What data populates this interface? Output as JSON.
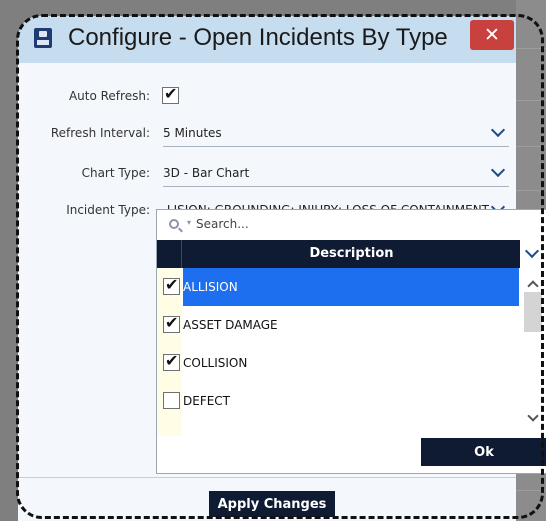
{
  "dialog": {
    "title": "Configure - Open Incidents By Type",
    "close_label": "✕"
  },
  "form": {
    "auto_refresh": {
      "label": "Auto Refresh:",
      "checked": true
    },
    "refresh_interval": {
      "label": "Refresh Interval:",
      "value": "5 Minutes"
    },
    "chart_type": {
      "label": "Chart Type:",
      "value": "3D - Bar Chart"
    },
    "incident_type": {
      "label": "Incident Type:",
      "value": "ALLISION; ASSET DAMAGE; COLLISION; GROUNDING; INJURY; LOSS OF CONTAINMENT"
    }
  },
  "dropdown": {
    "search_placeholder": "Search...",
    "column_header": "Description",
    "items": [
      {
        "label": "ALLISION",
        "checked": true,
        "selected": true
      },
      {
        "label": "ASSET DAMAGE",
        "checked": true,
        "selected": false
      },
      {
        "label": "COLLISION",
        "checked": true,
        "selected": false
      },
      {
        "label": "DEFECT",
        "checked": false,
        "selected": false
      }
    ],
    "ok_label": "Ok"
  },
  "footer": {
    "apply_label": "Apply Changes"
  },
  "icons": {
    "app": "app-icon",
    "close": "close-icon",
    "check": "✔",
    "chevron": "chevron-down-icon",
    "search": "search-icon"
  },
  "colors": {
    "titlebar": "#c6dcef",
    "close": "#c9413e",
    "navy": "#0f1a33",
    "selection": "#1e6ef0"
  }
}
